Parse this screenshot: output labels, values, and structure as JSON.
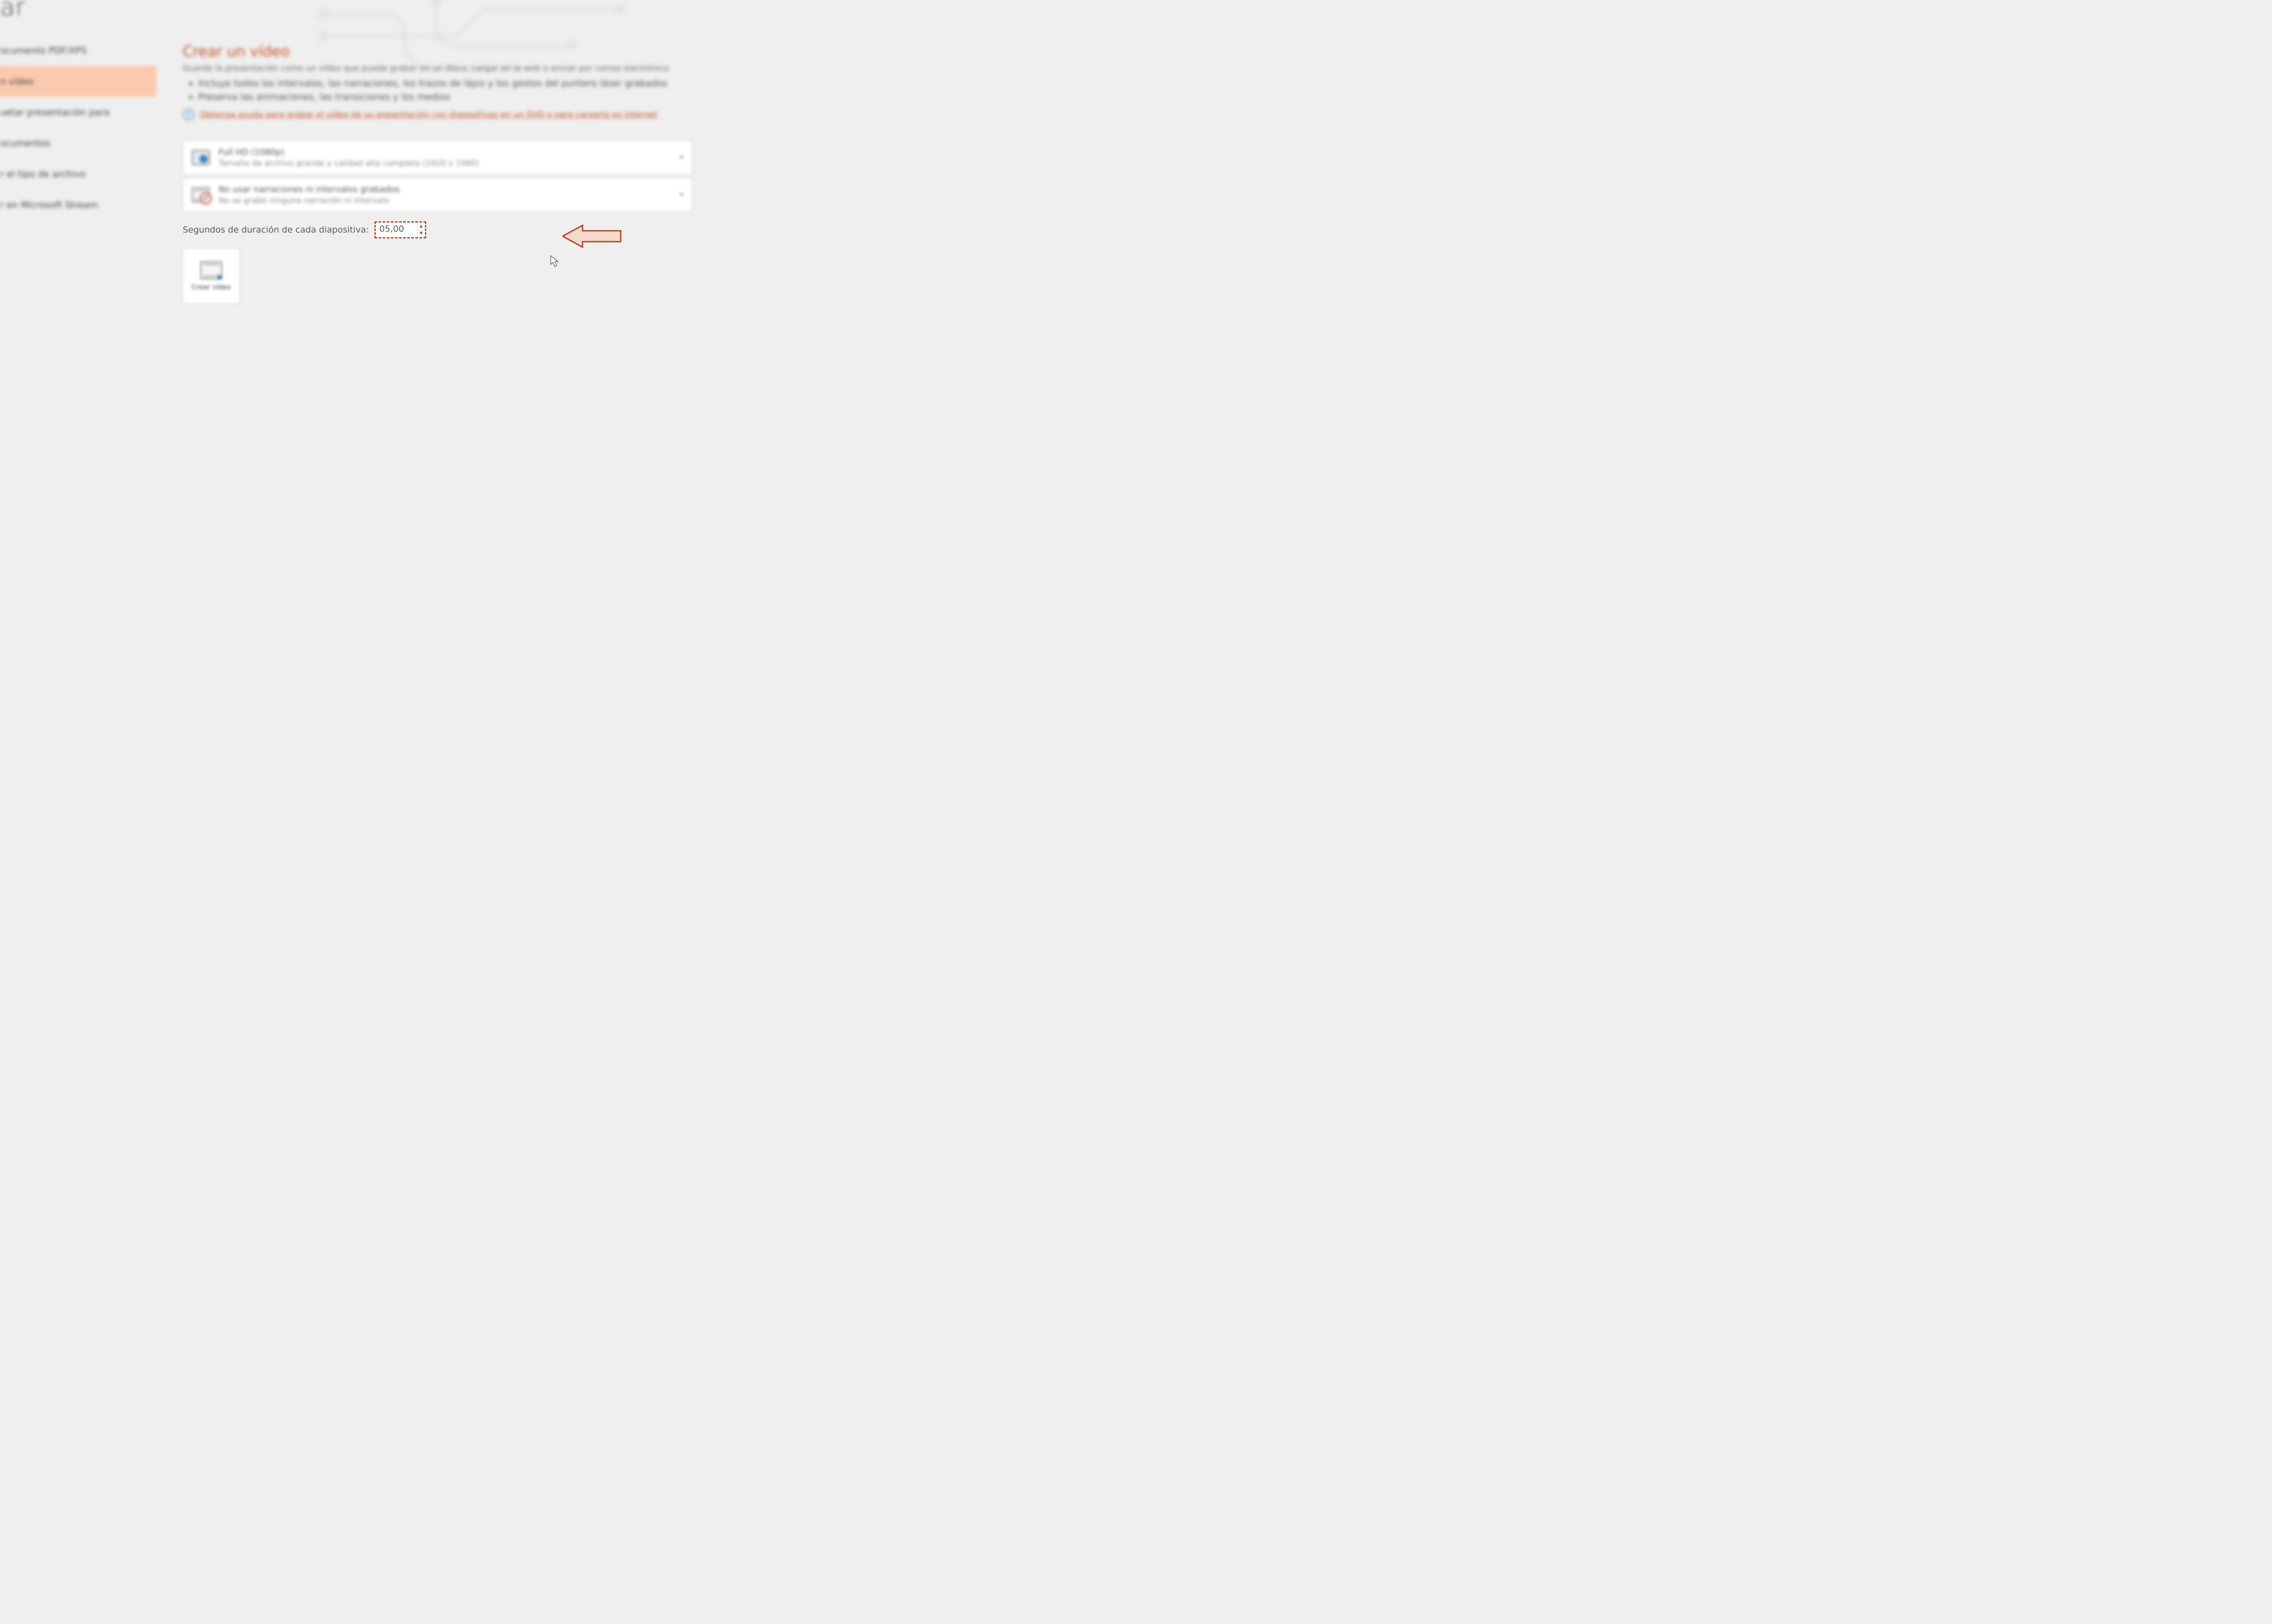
{
  "page_heading_partial": "ar",
  "sidebar": {
    "items": [
      {
        "label": "ocumento PDF/XPS"
      },
      {
        "label": "n vídeo"
      },
      {
        "label": "uetar presentación para"
      },
      {
        "label": "ocumentos"
      },
      {
        "label": "r el tipo de archivo"
      },
      {
        "label": "r en Microsoft Stream"
      }
    ],
    "selected_index": 1
  },
  "content": {
    "title": "Crear un vídeo",
    "intro": "Guarde la presentación como un vídeo que puede grabar en un disco, cargar en la web o enviar por correo electrónico",
    "bullets": [
      "Incluye todos los intervalos, las narraciones, los trazos de lápiz y los gestos del puntero láser grabados",
      "Preserva las animaciones, las transiciones y los medios"
    ],
    "help_link": "Obtenga ayuda para grabar el vídeo de su presentación con diapositivas en un DVD o para cargarla en Internet"
  },
  "quality_dropdown": {
    "title": "Full HD (1080p)",
    "subtitle": "Tamaño de archivo grande y calidad alta completa (1920 x 1080)"
  },
  "narration_dropdown": {
    "title": "No usar narraciones ni intervalos grabados",
    "subtitle": "No se grabó ninguna narración ni intervalo"
  },
  "duration": {
    "label": "Segundos de duración de cada diapositiva:",
    "value": "05,00"
  },
  "create_button": {
    "label": "Crear vídeo"
  },
  "colors": {
    "accent_orange": "#c55024",
    "sidebar_selected_bg": "#fbc9ae",
    "blue": "#2f7abf"
  }
}
